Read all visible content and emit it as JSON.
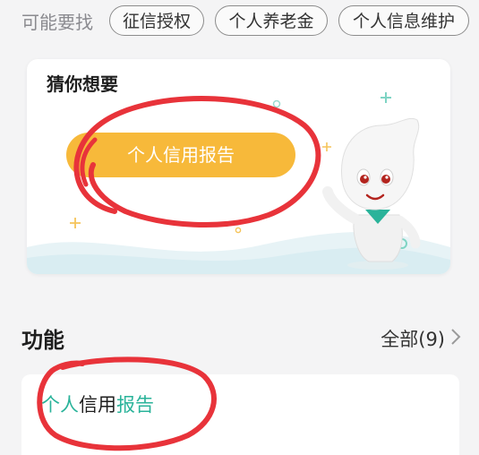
{
  "search_hints": {
    "label": "可能要找",
    "chips": [
      "征信授权",
      "个人养老金",
      "个人信息维护"
    ]
  },
  "guess_card": {
    "title": "猜你想要",
    "button_label": "个人信用报告",
    "button_color": "#f7b93a"
  },
  "functions": {
    "title": "功能",
    "all_label": "全部(9)",
    "items": [
      {
        "part_a": "个人",
        "part_b": "信用",
        "part_c": "报告"
      }
    ]
  },
  "colors": {
    "accent": "#2ab39a",
    "scribble": "#e8333a"
  }
}
